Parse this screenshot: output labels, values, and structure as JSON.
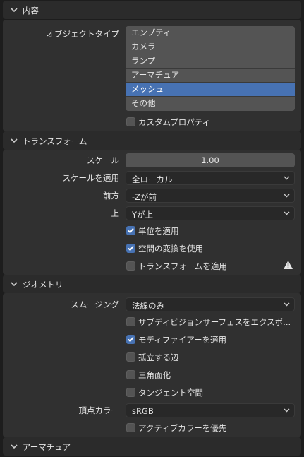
{
  "sections": {
    "content": {
      "title": "内容"
    },
    "transform": {
      "title": "トランスフォーム"
    },
    "geometry": {
      "title": "ジオメトリ"
    },
    "armature": {
      "title": "アーマチュア"
    }
  },
  "content": {
    "object_types_label": "オブジェクトタイプ",
    "object_types": [
      {
        "label": "エンプティ",
        "selected": false
      },
      {
        "label": "カメラ",
        "selected": false
      },
      {
        "label": "ランプ",
        "selected": false
      },
      {
        "label": "アーマチュア",
        "selected": false
      },
      {
        "label": "メッシュ",
        "selected": true
      },
      {
        "label": "その他",
        "selected": false
      }
    ],
    "custom_props_label": "カスタムプロパティ",
    "custom_props_checked": false
  },
  "transform": {
    "scale_label": "スケール",
    "scale_value": "1.00",
    "apply_scale_label": "スケールを適用",
    "apply_scale_value": "全ローカル",
    "forward_label": "前方",
    "forward_value": "-Zが前",
    "up_label": "上",
    "up_value": "Yが上",
    "apply_unit_label": "単位を適用",
    "apply_unit_checked": true,
    "space_transform_label": "空間の変換を使用",
    "space_transform_checked": true,
    "apply_transform_label": "トランスフォームを適用",
    "apply_transform_checked": false
  },
  "geometry": {
    "smoothing_label": "スムージング",
    "smoothing_value": "法線のみ",
    "export_subdiv_label": "サブディビジョンサーフェスをエクスポ...",
    "export_subdiv_checked": false,
    "apply_modifiers_label": "モディファイアーを適用",
    "apply_modifiers_checked": true,
    "loose_edges_label": "孤立する辺",
    "loose_edges_checked": false,
    "triangulate_label": "三角面化",
    "triangulate_checked": false,
    "tangent_space_label": "タンジェント空間",
    "tangent_space_checked": false,
    "vertex_color_label": "頂点カラー",
    "vertex_color_value": "sRGB",
    "prioritize_active_color_label": "アクティブカラーを優先",
    "prioritize_active_color_checked": false
  },
  "colors": {
    "accent": "#4772b3",
    "panel": "#303030",
    "background": "#1d1d1d"
  }
}
